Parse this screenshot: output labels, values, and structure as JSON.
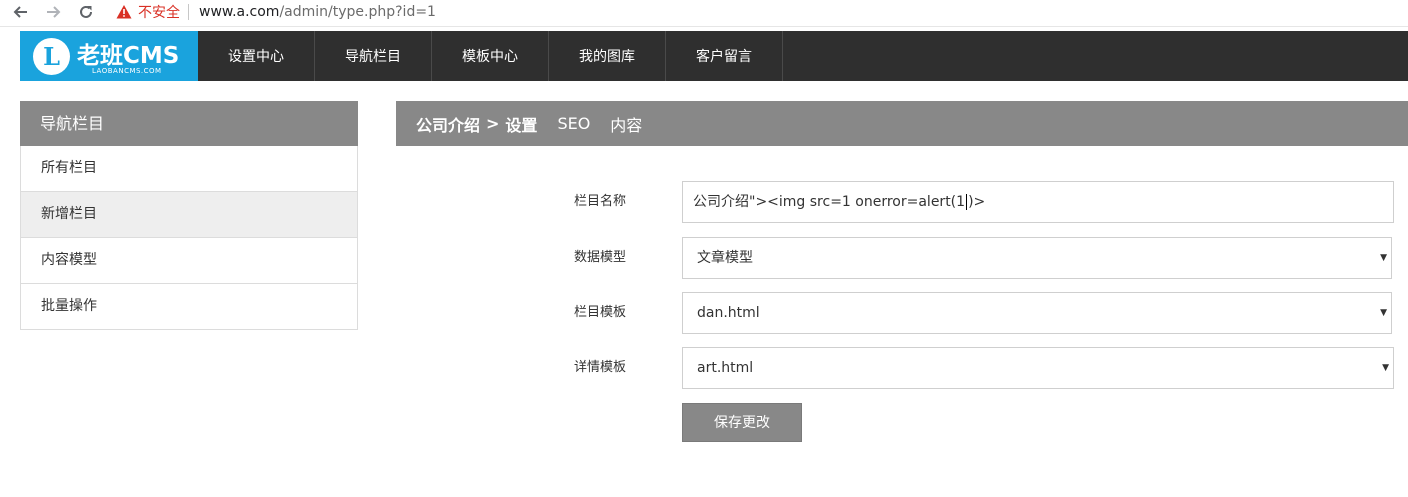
{
  "browser": {
    "insecure_label": "不安全",
    "url_host": "www.a.com",
    "url_path": "/admin/type.php?id=1"
  },
  "logo": {
    "letter": "L",
    "name": "老班CMS",
    "sub": "LAOBANCMS.COM"
  },
  "topnav": {
    "items": [
      {
        "label": "设置中心"
      },
      {
        "label": "导航栏目"
      },
      {
        "label": "模板中心"
      },
      {
        "label": "我的图库"
      },
      {
        "label": "客户留言"
      }
    ]
  },
  "sidebar": {
    "title": "导航栏目",
    "items": [
      {
        "label": "所有栏目"
      },
      {
        "label": "新增栏目"
      },
      {
        "label": "内容模型"
      },
      {
        "label": "批量操作"
      }
    ]
  },
  "main": {
    "breadcrumb": "公司介绍",
    "separator": ">",
    "tabs": [
      {
        "label": "设置"
      },
      {
        "label": "SEO"
      },
      {
        "label": "内容"
      }
    ]
  },
  "form": {
    "name_label": "栏目名称",
    "name_value_before_caret": "公司介绍\"><img src=1 onerror=alert(1",
    "name_value_after_caret": ")>",
    "model_label": "数据模型",
    "model_value": "文章模型",
    "list_tpl_label": "栏目模板",
    "list_tpl_value": "dan.html",
    "detail_tpl_label": "详情模板",
    "detail_tpl_value": "art.html",
    "save_label": "保存更改"
  },
  "icons": {
    "back": "arrow-left-icon",
    "forward": "arrow-right-icon",
    "reload": "reload-icon",
    "warning": "warning-triangle-icon",
    "dropdown": "caret-down-icon"
  },
  "colors": {
    "logo_bg": "#1aa3dd",
    "nav_bg": "#2f2f2f",
    "header_gray": "#888888",
    "warning_red": "#d93025"
  }
}
